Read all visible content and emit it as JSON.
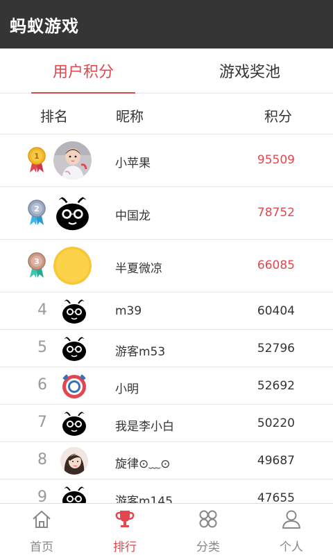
{
  "app": {
    "title": "蚂蚁游戏"
  },
  "tabs": [
    {
      "label": "用户积分",
      "active": true
    },
    {
      "label": "游戏奖池",
      "active": false
    }
  ],
  "columns": {
    "rank": "排名",
    "nickname": "昵称",
    "score": "积分"
  },
  "rows": [
    {
      "rank": "1",
      "nickname": "小苹果",
      "score": "95509",
      "avatar": "child-photo"
    },
    {
      "rank": "2",
      "nickname": "中国龙",
      "score": "78752",
      "avatar": "ant-mascot"
    },
    {
      "rank": "3",
      "nickname": "半夏微凉",
      "score": "66085",
      "avatar": "yellow-circle"
    },
    {
      "rank": "4",
      "nickname": "m39",
      "score": "60404",
      "avatar": "ant-mascot"
    },
    {
      "rank": "5",
      "nickname": "游客m53",
      "score": "52796",
      "avatar": "ant-mascot"
    },
    {
      "rank": "6",
      "nickname": "小明",
      "score": "52692",
      "avatar": "alarm-clock"
    },
    {
      "rank": "7",
      "nickname": "我是李小白",
      "score": "50220",
      "avatar": "ant-mascot"
    },
    {
      "rank": "8",
      "nickname": "旋律⊙﹏⊙",
      "score": "49687",
      "avatar": "girl-photo"
    },
    {
      "rank": "9",
      "nickname": "游客m145",
      "score": "47655",
      "avatar": "ant-mascot"
    }
  ],
  "bottom_nav": [
    {
      "label": "首页",
      "icon": "home-icon",
      "active": false
    },
    {
      "label": "排行",
      "icon": "trophy-icon",
      "active": true
    },
    {
      "label": "分类",
      "icon": "category-icon",
      "active": false
    },
    {
      "label": "个人",
      "icon": "person-icon",
      "active": false
    }
  ],
  "colors": {
    "header_bg": "#353535",
    "accent": "#e2474f",
    "gold": "#f2b827",
    "silver": "#9aa7c0",
    "bronze": "#c99a86"
  }
}
